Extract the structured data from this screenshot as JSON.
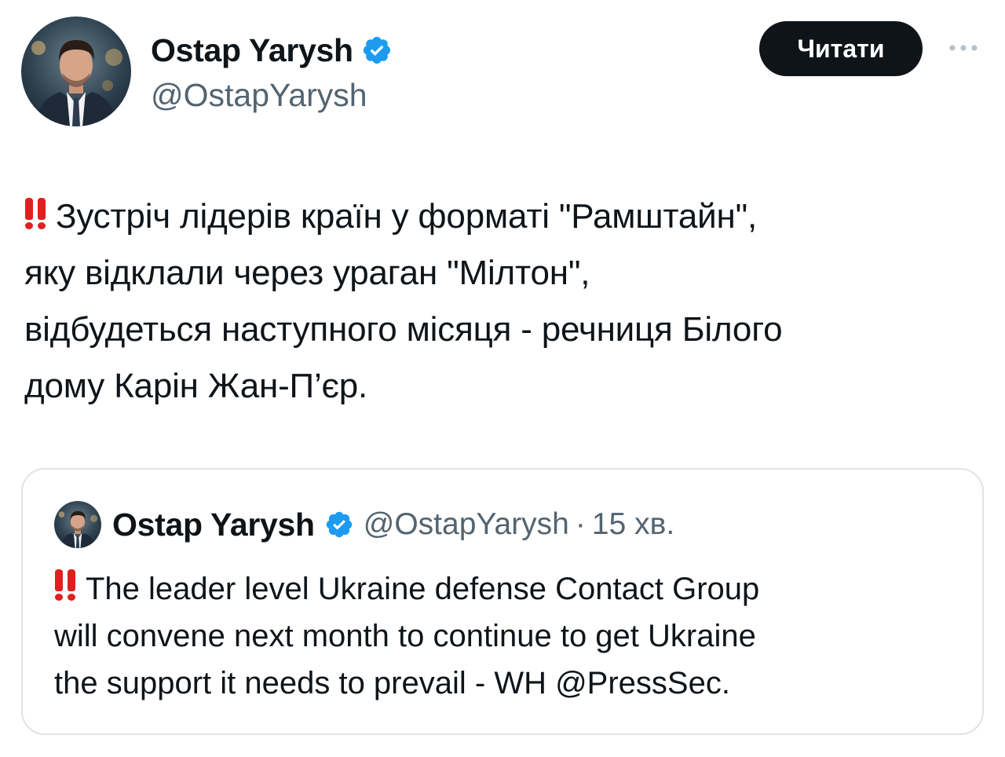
{
  "author": {
    "name": "Ostap Yarysh",
    "handle": "@OstapYarysh",
    "verified": true
  },
  "actions": {
    "read_button_label": "Читати",
    "more_icon": "more-horizontal-icon"
  },
  "tweet": {
    "emoji": "‼️",
    "lines": [
      "Зустріч лідерів країн у форматі \"Рамштайн\",",
      "яку відклали через ураган \"Мілтон\",",
      "відбудеться наступного місяця - речниця Білого",
      "дому Карін Жан-П’єр."
    ]
  },
  "quoted_tweet": {
    "author_name": "Ostap Yarysh",
    "handle": "@OstapYarysh",
    "separator": "·",
    "time": "15 хв.",
    "emoji": "‼️",
    "lines": [
      "The leader level Ukraine defense Contact Group",
      "will convene next month to continue to get Ukraine",
      "the support it needs to prevail - WH @PressSec."
    ]
  },
  "colors": {
    "text_primary": "#0f1419",
    "text_secondary": "#536471",
    "verified_blue": "#1d9bf0",
    "button_bg": "#0f1419",
    "border": "#dfe3e6",
    "emoji_red": "#e0201f"
  }
}
